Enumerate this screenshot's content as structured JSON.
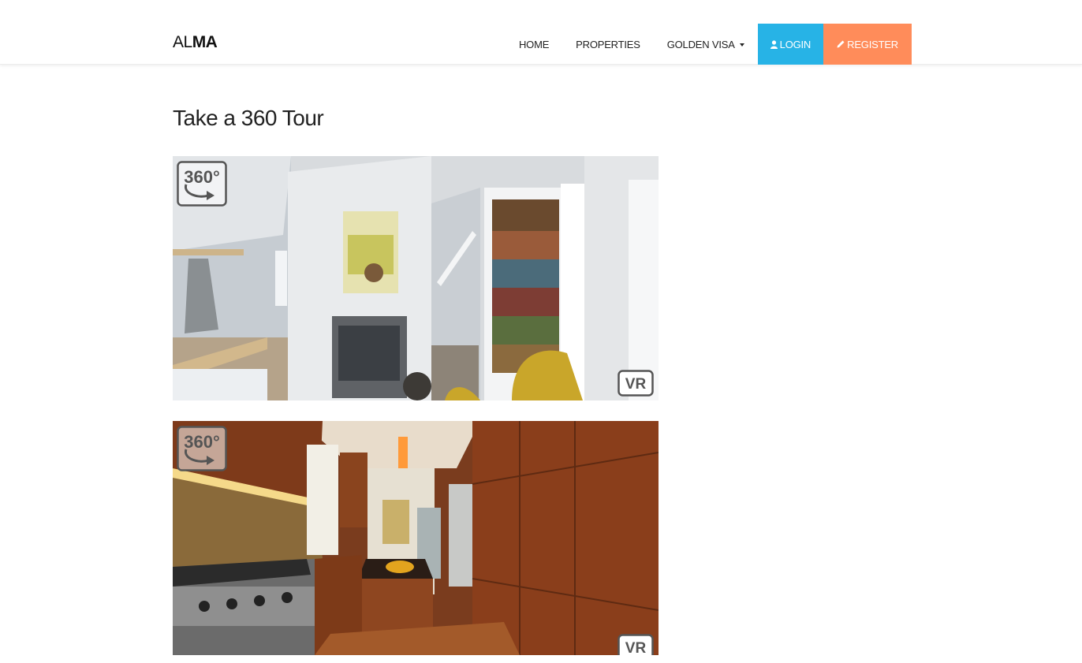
{
  "header": {
    "brand_light": "AL",
    "brand_bold": "MA",
    "nav": {
      "home": "HOME",
      "properties": "PROPERTIES",
      "golden_visa": "GOLDEN VISA",
      "login": "LOGIN",
      "register": "REGISTER"
    },
    "icons": {
      "login": "user-icon",
      "register": "pencil-icon",
      "dropdown": "caret-down-icon"
    }
  },
  "main": {
    "title": "Take a 360 Tour",
    "tours": [
      {
        "badge_360": "360°",
        "badge_vr": "VR"
      },
      {
        "badge_360": "360°",
        "badge_vr": "VR"
      }
    ]
  },
  "colors": {
    "login_bg": "#27b3e6",
    "register_bg": "#ff8c5a"
  }
}
